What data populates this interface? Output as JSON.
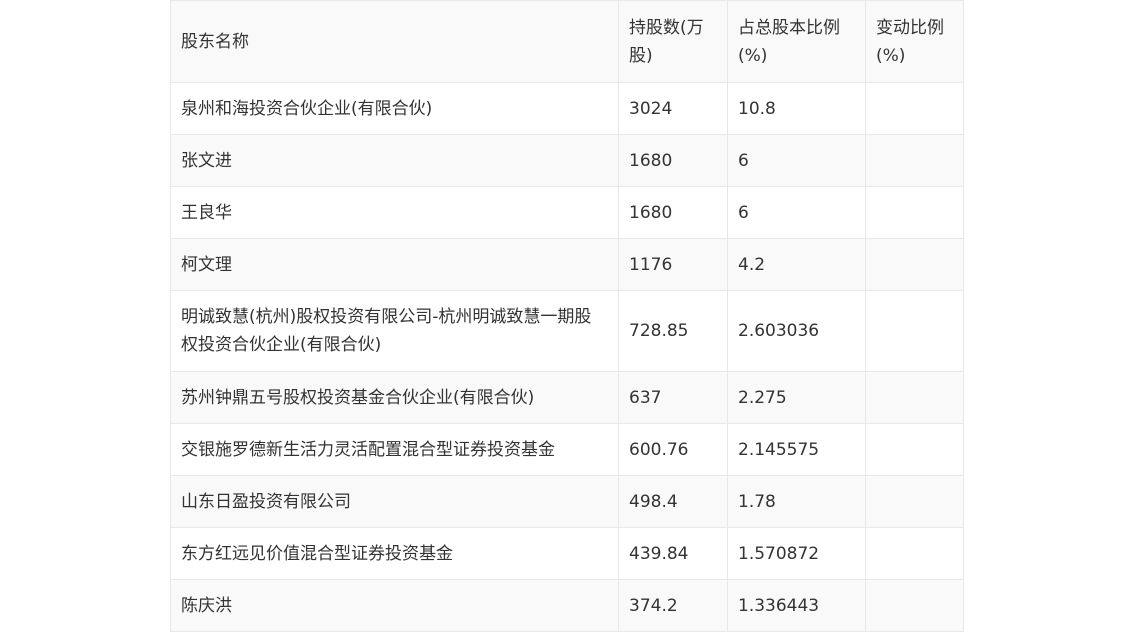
{
  "table": {
    "headers": [
      "股东名称",
      "持股数(万股)",
      "占总股本比例(%)",
      "变动比例(%)"
    ],
    "rows": [
      {
        "name": "泉州和海投资合伙企业(有限合伙)",
        "shares": "3024",
        "ratio": "10.8",
        "change": ""
      },
      {
        "name": "张文进",
        "shares": "1680",
        "ratio": "6",
        "change": ""
      },
      {
        "name": "王良华",
        "shares": "1680",
        "ratio": "6",
        "change": ""
      },
      {
        "name": "柯文理",
        "shares": "1176",
        "ratio": "4.2",
        "change": ""
      },
      {
        "name": "明诚致慧(杭州)股权投资有限公司-杭州明诚致慧一期股权投资合伙企业(有限合伙)",
        "shares": "728.85",
        "ratio": "2.603036",
        "change": ""
      },
      {
        "name": "苏州钟鼎五号股权投资基金合伙企业(有限合伙)",
        "shares": "637",
        "ratio": "2.275",
        "change": ""
      },
      {
        "name": "交银施罗德新生活力灵活配置混合型证券投资基金",
        "shares": "600.76",
        "ratio": "2.145575",
        "change": ""
      },
      {
        "name": "山东日盈投资有限公司",
        "shares": "498.4",
        "ratio": "1.78",
        "change": ""
      },
      {
        "name": "东方红远见价值混合型证券投资基金",
        "shares": "439.84",
        "ratio": "1.570872",
        "change": ""
      },
      {
        "name": "陈庆洪",
        "shares": "374.2",
        "ratio": "1.336443",
        "change": ""
      }
    ]
  }
}
